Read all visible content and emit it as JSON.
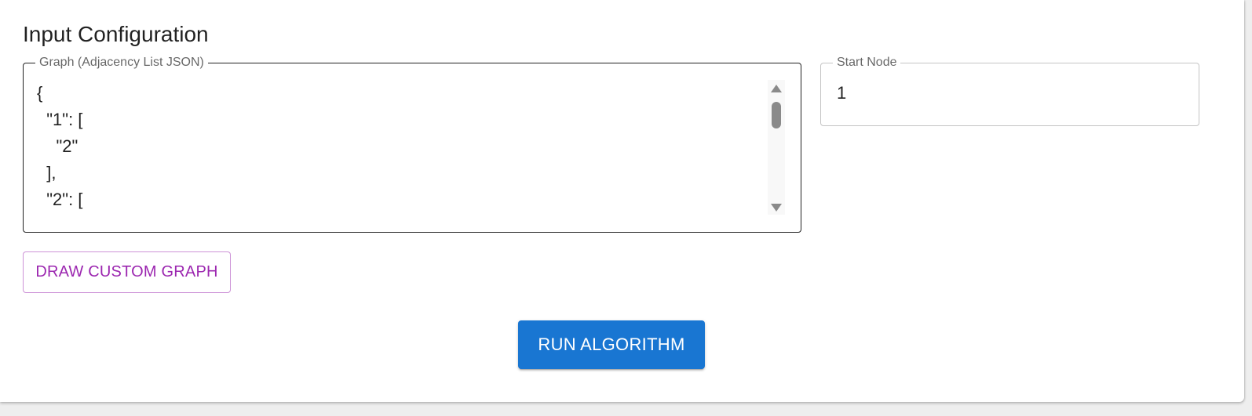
{
  "section": {
    "title": "Input Configuration"
  },
  "graph_field": {
    "label": "Graph (Adjacency List JSON)",
    "value": "{\n  \"1\": [\n    \"2\"\n  ],\n  \"2\": ["
  },
  "start_field": {
    "label": "Start Node",
    "value": "1"
  },
  "buttons": {
    "draw_custom_graph": "DRAW CUSTOM GRAPH",
    "run_algorithm": "RUN ALGORITHM"
  },
  "colors": {
    "primary": "#1976d2",
    "secondary": "#9c27b0"
  }
}
